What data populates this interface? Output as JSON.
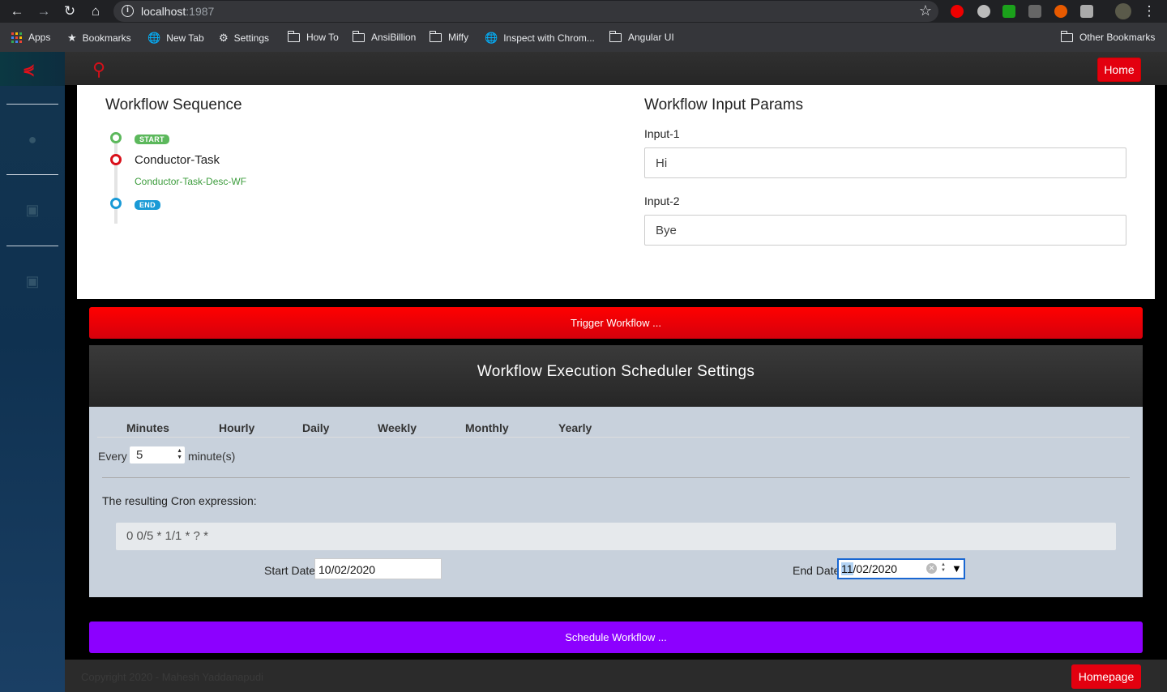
{
  "browser": {
    "url_host": "localhost",
    "url_port": ":1987",
    "bookmarks": [
      {
        "label": "Apps",
        "icon": "apps-grid-icon"
      },
      {
        "label": "Bookmarks",
        "icon": "star-icon"
      },
      {
        "label": "New Tab",
        "icon": "globe-icon"
      },
      {
        "label": "Settings",
        "icon": "gear-icon"
      },
      {
        "label": "How To",
        "icon": "folder-icon"
      },
      {
        "label": "AnsiBillion",
        "icon": "folder-icon"
      },
      {
        "label": "Miffy",
        "icon": "folder-icon"
      },
      {
        "label": "Inspect with Chrom...",
        "icon": "globe-icon"
      },
      {
        "label": "Angular UI",
        "icon": "folder-icon"
      },
      {
        "label": "Other Bookmarks",
        "icon": "folder-icon"
      }
    ]
  },
  "header": {
    "home_label": "Home"
  },
  "workflow": {
    "sequence_title": "Workflow Sequence",
    "start_badge": "START",
    "task_name": "Conductor-Task",
    "task_desc": "Conductor-Task-Desc-WF",
    "end_badge": "END",
    "params_title": "Workflow Input Params",
    "params": [
      {
        "label": "Input-1",
        "value": "Hi"
      },
      {
        "label": "Input-2",
        "value": "Bye"
      }
    ],
    "trigger_label": "Trigger Workflow ..."
  },
  "scheduler": {
    "title": "Workflow Execution Scheduler Settings",
    "tabs": [
      "Minutes",
      "Hourly",
      "Daily",
      "Weekly",
      "Monthly",
      "Yearly"
    ],
    "every_label": "Every",
    "every_value": "5",
    "every_unit": "minute(s)",
    "cron_label": "The resulting Cron expression:",
    "cron_value": "0 0/5 * 1/1 * ? *",
    "start_label": "Start Date",
    "start_value": "10/02/2020",
    "end_label": "End Date",
    "end_value_sel": "11",
    "end_value_rest": "/02/2020",
    "schedule_label": "Schedule Workflow ..."
  },
  "footer": {
    "copyright": "Copyright 2020 - Mahesh Yaddanapudi",
    "homepage_label": "Homepage"
  },
  "colors": {
    "accent_red": "#e3000f",
    "schedule_purple": "#8c00ff",
    "start_green": "#5cb85c",
    "end_blue": "#1a9ad6"
  }
}
